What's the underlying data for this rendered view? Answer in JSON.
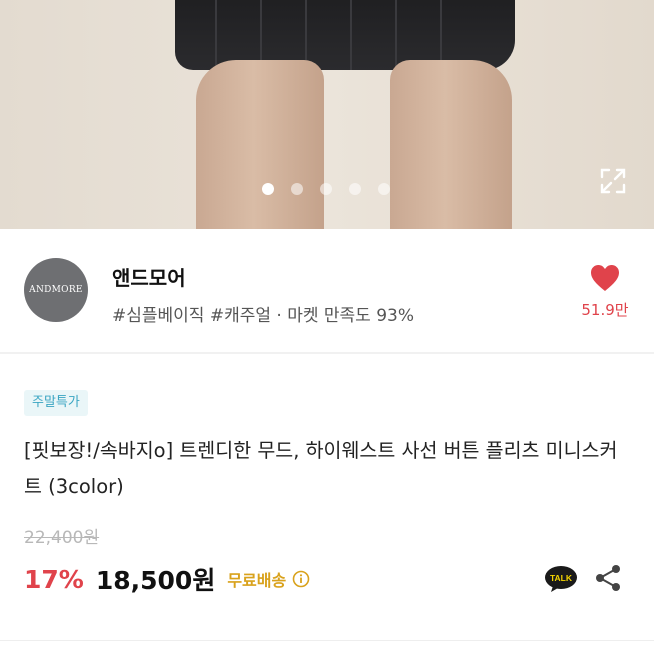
{
  "carousel": {
    "image": "product-photo-skirt",
    "page_count": 5,
    "active_index": 0,
    "expand_icon": "expand-icon"
  },
  "seller": {
    "avatar_text": "ANDMORE",
    "name": "앤드모어",
    "tags": "#심플베이직 #캐주얼 · 마켓 만족도 93%",
    "likes": "51.9만",
    "heart_color": "#e0434b"
  },
  "product": {
    "badge": "주말특가",
    "title": "[핏보장!/속바지o] 트렌디한 무드, 하이웨스트 사선 버튼 플리츠 미니스커트 (3color)",
    "original_price": "22,400원",
    "discount": "17%",
    "price": "18,500원",
    "shipping": "무료배송",
    "accent_color": "#e0434b",
    "shipping_color": "#d9a21c"
  },
  "actions": {
    "talk_label": "TALK",
    "share_icon": "share-icon"
  }
}
